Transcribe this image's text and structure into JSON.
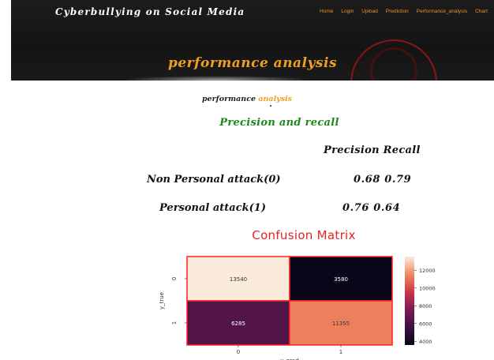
{
  "header": {
    "brand": "Cyberbullying on Social Media",
    "nav": [
      "Home",
      "Login",
      "Upload",
      "Prediction",
      "Performance_analysis",
      "Chart"
    ],
    "banner_title": "performance analysis",
    "colors": {
      "accent": "#f0a020",
      "nav": "#e8902c",
      "background": "#1c1c1c"
    }
  },
  "main": {
    "subheading_part1": "performance",
    "subheading_part2": "analysis",
    "section_heading": "Precision and recall",
    "metric_header": "Precision Recall",
    "rows": [
      {
        "label": "Non Personal attack(0)",
        "values": "0.68 0.79"
      },
      {
        "label": "Personal attack(1)",
        "values": "0.76 0.64"
      }
    ]
  },
  "chart_data": {
    "type": "heatmap",
    "title": "Confusion Matrix",
    "xlabel": "y_pred",
    "ylabel": "y_true",
    "x_categories": [
      "0",
      "1"
    ],
    "y_categories": [
      "0",
      "1"
    ],
    "values": [
      [
        13540,
        3580
      ],
      [
        6285,
        11355
      ]
    ],
    "colorbar_ticks": [
      12000,
      10000,
      8000,
      6000,
      4000
    ],
    "colorbar_range": [
      3580,
      13540
    ],
    "colormap": "rocket",
    "border_color": "#ff2020"
  }
}
